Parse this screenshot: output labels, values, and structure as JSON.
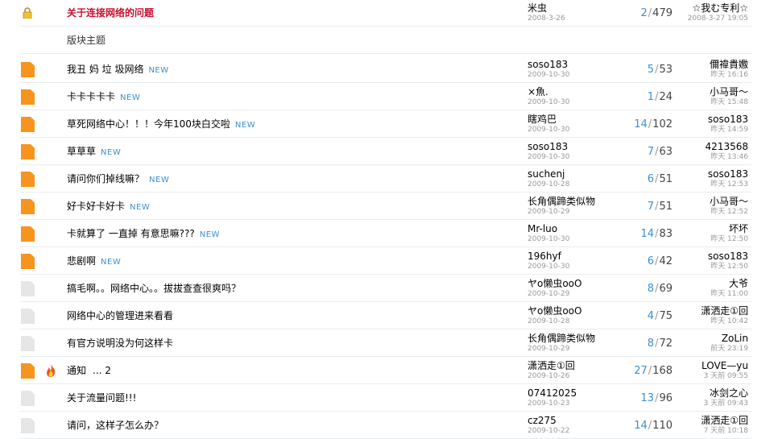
{
  "pinned": {
    "title": "关于连接网络的问题",
    "author": "米虫",
    "author_date": "2008-3-26",
    "replies": "2",
    "views": "479",
    "last_user": "☆我む专利☆",
    "last_date": "2008-3-27 19:05"
  },
  "section_header": "版块主题",
  "new_label": "NEW",
  "threads": [
    {
      "title": "我丑 妈 垃 圾网络",
      "is_new": true,
      "icon": "unread",
      "author": "soso183",
      "author_date": "2009-10-30",
      "replies": "5",
      "views": "53",
      "last_user": "儞禕貴嫐",
      "last_date": "昨天 16:16"
    },
    {
      "title": "卡卡卡卡卡",
      "is_new": true,
      "icon": "unread",
      "author": "×魚.",
      "author_date": "2009-10-30",
      "replies": "1",
      "views": "24",
      "last_user": "小马哥～",
      "last_date": "昨天 15:48"
    },
    {
      "title": "草死网络中心！！！今年100块白交啦",
      "is_new": true,
      "icon": "unread",
      "author": "瞎鸡巴",
      "author_date": "2009-10-30",
      "replies": "14",
      "views": "102",
      "last_user": "soso183",
      "last_date": "昨天 14:59"
    },
    {
      "title": "草草草",
      "is_new": true,
      "icon": "unread",
      "author": "soso183",
      "author_date": "2009-10-30",
      "replies": "7",
      "views": "63",
      "last_user": "4213568",
      "last_date": "昨天 13:46"
    },
    {
      "title": "请问你们掉线嘛？",
      "is_new": true,
      "icon": "unread",
      "author": "suchenj",
      "author_date": "2009-10-28",
      "replies": "6",
      "views": "51",
      "last_user": "soso183",
      "last_date": "昨天 12:53"
    },
    {
      "title": "好卡好卡好卡",
      "is_new": true,
      "icon": "unread",
      "author": "长角偶蹄类似物",
      "author_date": "2009-10-29",
      "replies": "7",
      "views": "51",
      "last_user": "小马哥～",
      "last_date": "昨天 12:52"
    },
    {
      "title": "卡就算了 一直掉 有意思嘛???",
      "is_new": true,
      "icon": "unread",
      "author": "Mr-luo",
      "author_date": "2009-10-30",
      "replies": "14",
      "views": "83",
      "last_user": "坏坏",
      "last_date": "昨天 12:50"
    },
    {
      "title": "悲剧啊",
      "is_new": true,
      "icon": "unread",
      "author": "196hyf",
      "author_date": "2009-10-30",
      "replies": "6",
      "views": "42",
      "last_user": "soso183",
      "last_date": "昨天 12:50"
    },
    {
      "title": "搞毛啊。。网络中心。。拔拔查查很爽吗？",
      "is_new": false,
      "icon": "read",
      "author": "ヤo懒虫ooO",
      "author_date": "2009-10-29",
      "replies": "8",
      "views": "69",
      "last_user": "大爷",
      "last_date": "昨天 11:00"
    },
    {
      "title": "网络中心的管理进来看看",
      "is_new": false,
      "icon": "read",
      "author": "ヤo懒虫ooO",
      "author_date": "2009-10-28",
      "replies": "4",
      "views": "75",
      "last_user": "潇洒走①回",
      "last_date": "昨天 10:42"
    },
    {
      "title": "有官方说明没为何这样卡",
      "is_new": false,
      "icon": "read",
      "author": "长角偶蹄类似物",
      "author_date": "2009-10-29",
      "replies": "8",
      "views": "72",
      "last_user": "ZoLin",
      "last_date": "前天 23:19"
    },
    {
      "title": "通知",
      "is_new": false,
      "icon": "unread",
      "hot": true,
      "pages": "... 2",
      "author": "潇洒走①回",
      "author_date": "2009-10-26",
      "replies": "27",
      "views": "168",
      "last_user": "LOVE—yu",
      "last_date": "3 天前 09:55"
    },
    {
      "title": "关于流量问题!!!",
      "is_new": false,
      "icon": "read",
      "author": "07412025",
      "author_date": "2009-10-23",
      "replies": "13",
      "views": "96",
      "last_user": "冰剑之心",
      "last_date": "3 天前 09:43"
    },
    {
      "title": "请问，这样子怎么办？",
      "is_new": false,
      "icon": "read",
      "author": "cz275",
      "author_date": "2009-10-22",
      "replies": "14",
      "views": "110",
      "last_user": "潇洒走①回",
      "last_date": "7 天前 10:18"
    }
  ]
}
